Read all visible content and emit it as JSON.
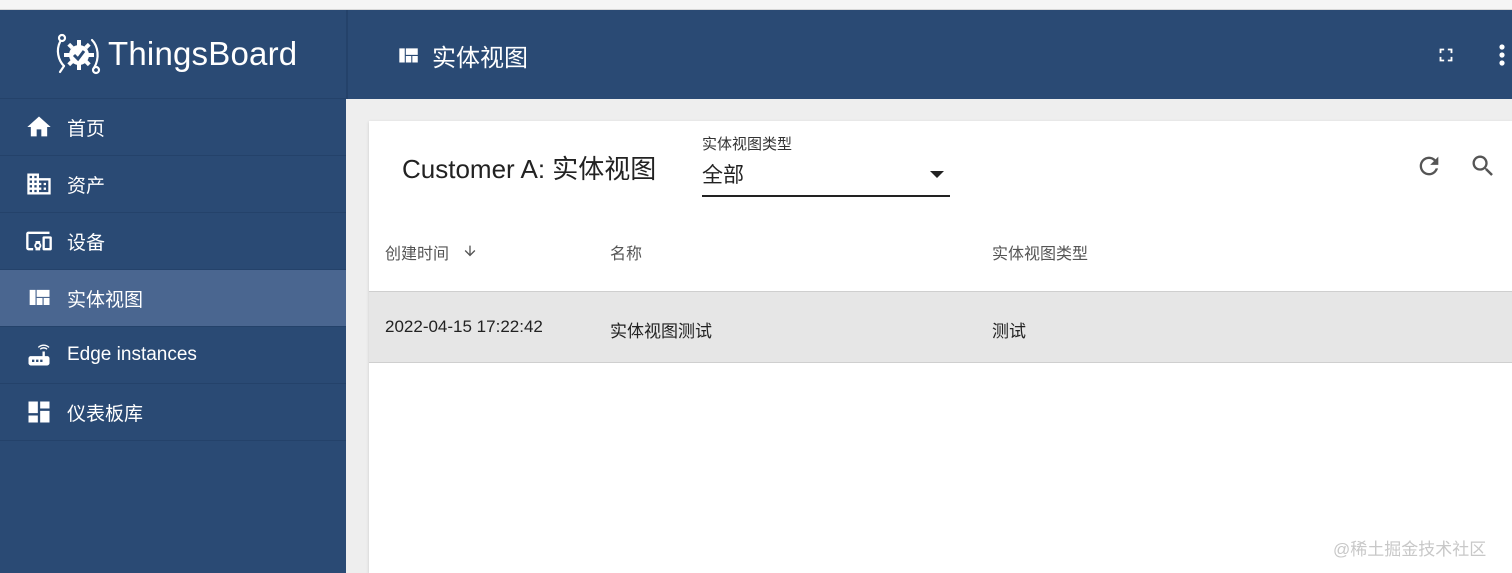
{
  "app": {
    "name": "ThingsBoard"
  },
  "sidebar": {
    "items": [
      {
        "label": "首页",
        "icon": "home-icon"
      },
      {
        "label": "资产",
        "icon": "domain-icon"
      },
      {
        "label": "设备",
        "icon": "devices-icon"
      },
      {
        "label": "实体视图",
        "icon": "view-quilt-icon",
        "active": true
      },
      {
        "label": "Edge instances",
        "icon": "router-icon"
      },
      {
        "label": "仪表板库",
        "icon": "dashboard-icon"
      }
    ]
  },
  "header": {
    "title": "实体视图",
    "icon": "view-quilt-icon"
  },
  "page": {
    "title": "Customer A: 实体视图",
    "filter": {
      "label": "实体视图类型",
      "value": "全部"
    }
  },
  "table": {
    "columns": [
      "创建时间",
      "名称",
      "实体视图类型"
    ],
    "sort": {
      "column": "创建时间",
      "direction": "desc"
    },
    "rows": [
      {
        "created": "2022-04-15 17:22:42",
        "name": "实体视图测试",
        "type": "测试"
      }
    ]
  },
  "watermark": "@稀土掘金技术社区",
  "colors": {
    "primary": "#2a4a74",
    "active": "#4a6690",
    "row_highlight": "#e6e6e6"
  }
}
